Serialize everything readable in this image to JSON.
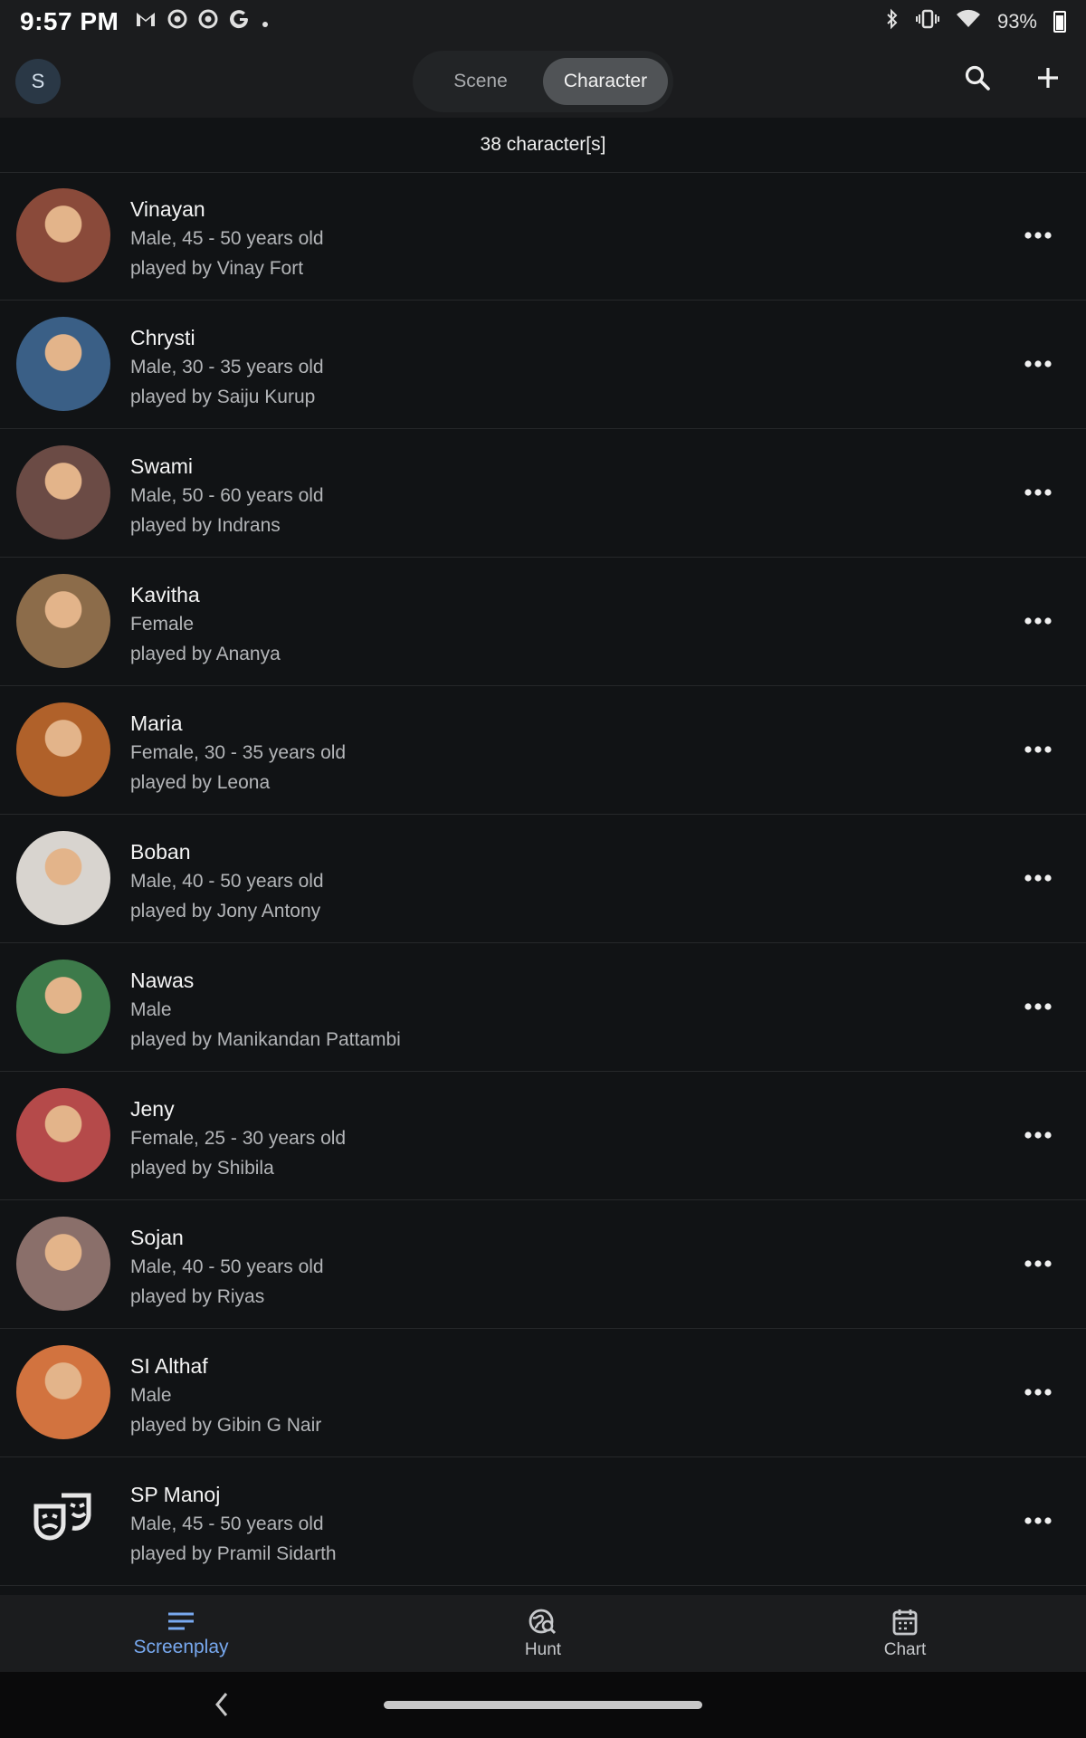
{
  "status_bar": {
    "time": "9:57 PM",
    "battery": "93%"
  },
  "app_bar": {
    "avatar_letter": "S",
    "tabs": [
      {
        "label": "Scene",
        "active": false
      },
      {
        "label": "Character",
        "active": true
      }
    ]
  },
  "list_header": {
    "count_text": "38 character[s]"
  },
  "characters": [
    {
      "name": "Vinayan",
      "meta": "Male, 45 - 50 years old",
      "actor": "played by Vinay Fort",
      "color": "#8a4a3a"
    },
    {
      "name": "Chrysti",
      "meta": "Male, 30 - 35 years old",
      "actor": "played by Saiju Kurup",
      "color": "#3a5f86"
    },
    {
      "name": "Swami",
      "meta": "Male, 50 - 60 years old",
      "actor": "played by Indrans",
      "color": "#6b4b45"
    },
    {
      "name": "Kavitha",
      "meta": "Female",
      "actor": "played by Ananya",
      "color": "#8c6c4a"
    },
    {
      "name": "Maria",
      "meta": "Female, 30 - 35 years old",
      "actor": "played by Leona",
      "color": "#b0612a"
    },
    {
      "name": "Boban",
      "meta": "Male, 40 - 50 years old",
      "actor": "played by Jony Antony",
      "color": "#d8d4cf"
    },
    {
      "name": "Nawas",
      "meta": "Male",
      "actor": "played by Manikandan Pattambi",
      "color": "#3d7a4a"
    },
    {
      "name": "Jeny",
      "meta": "Female, 25 - 30 years old",
      "actor": "played by Shibila",
      "color": "#b54a4a"
    },
    {
      "name": "Sojan",
      "meta": "Male, 40 - 50 years old",
      "actor": "played by Riyas",
      "color": "#8a6f6a"
    },
    {
      "name": "SI Althaf",
      "meta": "Male",
      "actor": "played by Gibin G Nair",
      "color": "#d2733f"
    },
    {
      "name": "SP Manoj",
      "meta": "Male, 45 - 50 years old",
      "actor": "played by Pramil Sidarth",
      "color": "",
      "placeholder": true
    }
  ],
  "bottom_nav": {
    "items": [
      {
        "label": "Screenplay",
        "icon": "lines-icon",
        "active": true
      },
      {
        "label": "Hunt",
        "icon": "globe-search-icon",
        "active": false
      },
      {
        "label": "Chart",
        "icon": "calendar-icon",
        "active": false
      }
    ]
  },
  "colors": {
    "background": "#111315",
    "appbar": "#1b1c1e",
    "accent": "#78a9f0"
  }
}
